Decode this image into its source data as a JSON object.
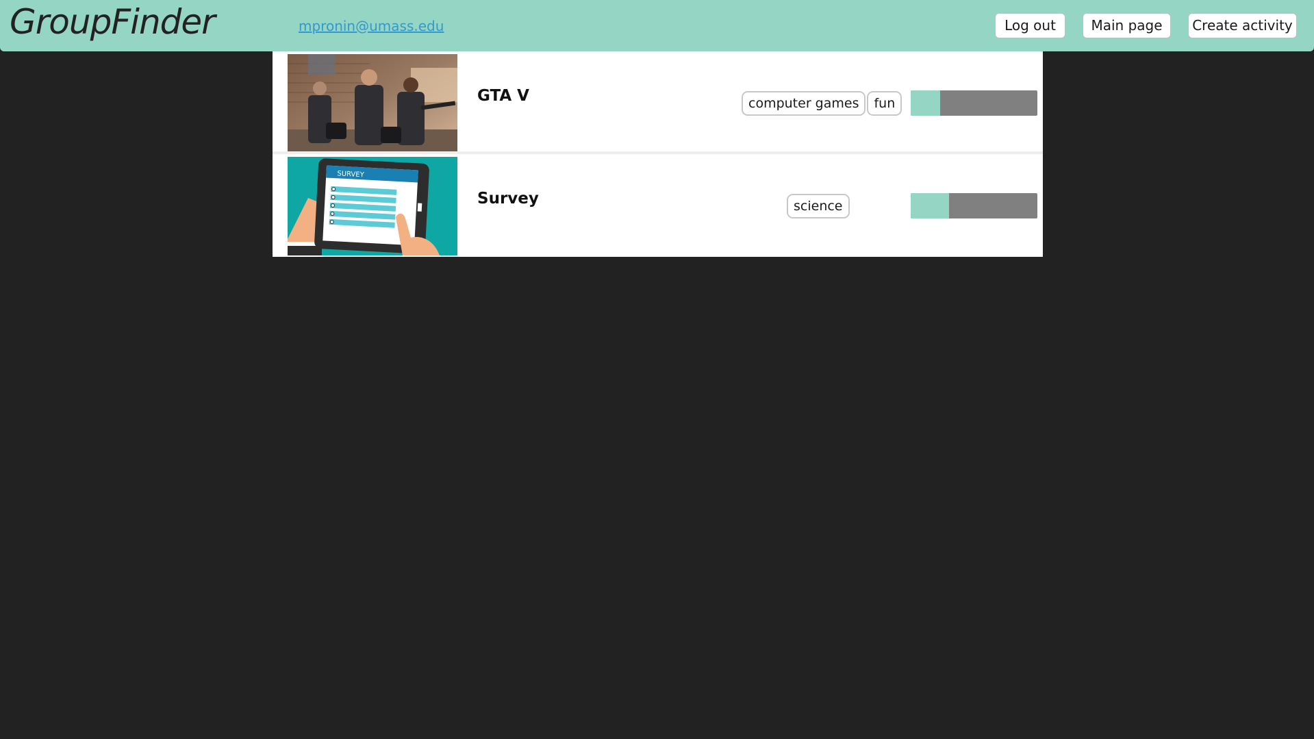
{
  "header": {
    "brand": "GroupFinder",
    "user_email": "mpronin@umass.edu",
    "logout_label": "Log out",
    "main_page_label": "Main page",
    "create_activity_label": "Create activity"
  },
  "activities": [
    {
      "title": "GTA V",
      "tags": [
        "computer games",
        "fun"
      ],
      "progress": 0.23
    },
    {
      "title": "Survey",
      "tags": [
        "science"
      ],
      "progress": 0.3,
      "image_text": "SURVEY"
    }
  ],
  "colors": {
    "accent": "#94d6c3",
    "background": "#222222",
    "progress_track": "#808080",
    "link": "#3399cc"
  }
}
